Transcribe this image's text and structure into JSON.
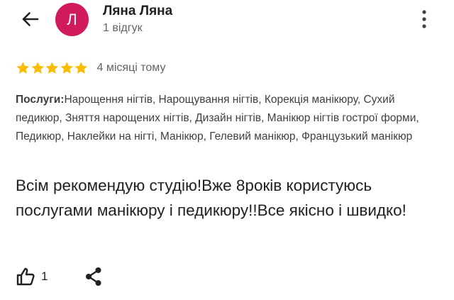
{
  "header": {
    "back_icon": "arrow-left-icon",
    "avatar_letter": "Л",
    "avatar_color": "#d01a5b",
    "author_name": "Ляна Ляна",
    "review_count": "1 відгук",
    "more_icon": "more-vertical-icon"
  },
  "review": {
    "rating": 5,
    "rating_max": 5,
    "star_color": "#fbbc04",
    "date": "4 місяці тому",
    "services_label": "Послуги:",
    "services_text": "Нарощення нігтів, Нарощування нігтів, Корекція манікюру, Сухий педикюр, Зняття нарощених нігтів, Дизайн нігтів, Манікюр нігтів гострої форми, Педикюр, Наклейки на нігті, Манікюр, Гелевий манікюр, Французький манікюр",
    "text": "Всім рекомендую студію!Вже 8років користуюсь послугами манікюру і педикюру!!Все якісно і швидко!"
  },
  "actions": {
    "like_icon": "thumb-up-icon",
    "like_count": "1",
    "share_icon": "share-icon"
  }
}
